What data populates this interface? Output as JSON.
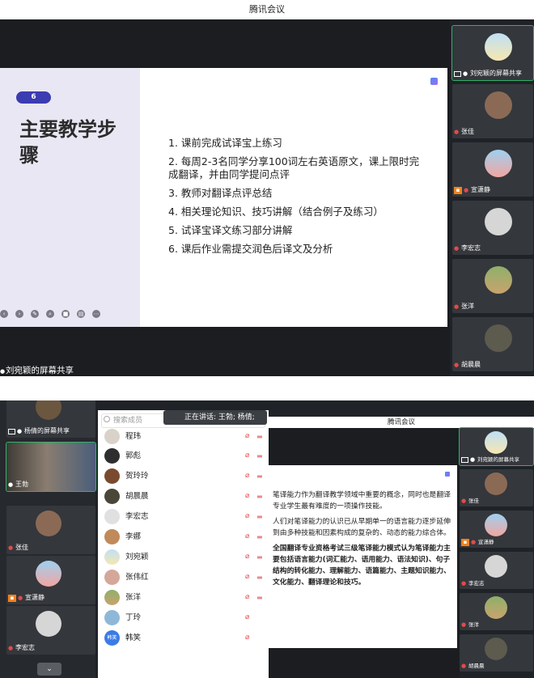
{
  "top_window": {
    "title": "腾讯会议",
    "slide": {
      "badge": "6",
      "title": "主要教学步骤",
      "items": [
        "1. 课前完成试译宝上练习",
        "2. 每周2-3名同学分享100词左右英语原文，课上限时完成翻译，并由同学提问点评",
        "3. 教师对翻译点评总结",
        "4. 相关理论知识、技巧讲解（结合例子及练习）",
        "5. 试译宝译文练习部分讲解",
        "6. 课后作业需提交润色后译文及分析"
      ]
    },
    "share_label": "刘宛颖的屏幕共享",
    "participants": [
      {
        "name": "刘宛颖的屏幕共享",
        "mic": "on",
        "share": true
      },
      {
        "name": "张佳",
        "mic": "off"
      },
      {
        "name": "宣潇静",
        "mic": "off",
        "camera": true
      },
      {
        "name": "李宏志",
        "mic": "off"
      },
      {
        "name": "张洋",
        "mic": "off"
      },
      {
        "name": "胡晨晨",
        "mic": "off"
      }
    ]
  },
  "bottom_window": {
    "title": "腾讯会议",
    "speaking": "正在讲话: 王勃; 杨倩;",
    "search_placeholder": "搜索成员",
    "left_tiles": [
      {
        "name": "杨倩的屏幕共享",
        "mic": "on",
        "share": true
      },
      {
        "name": "王勃",
        "mic": "on"
      },
      {
        "name": "张佳",
        "mic": "off"
      },
      {
        "name": "宣潇静",
        "mic": "off",
        "camera": true
      },
      {
        "name": "李宏志",
        "mic": "off"
      }
    ],
    "members": [
      {
        "name": "程玮"
      },
      {
        "name": "郭彪"
      },
      {
        "name": "贺玲玲"
      },
      {
        "name": "胡晨晨"
      },
      {
        "name": "李宏志"
      },
      {
        "name": "李娜"
      },
      {
        "name": "刘宛颖"
      },
      {
        "name": "张伟红"
      },
      {
        "name": "张洋"
      },
      {
        "name": "丁玲"
      },
      {
        "name": "韩笑",
        "avatar_text": "韩笑"
      }
    ],
    "slide_paragraphs": [
      "笔译能力作为翻译教学领域中重要的概念，同时也是翻译专业学生最有难度的一项操作技能。",
      "人们对笔译能力的认识已从早期单一的语言能力逐步延伸到由多种技能和因素构成的复杂的、动态的能力综合体。",
      "全国翻译专业资格考试三级笔译能力模式认为笔译能力主要包括语言能力(词汇能力、语用能力、语法知识)、句子结构的转化能力、理解能力、语篇能力、主题知识能力、文化能力、翻译理论和技巧。"
    ],
    "right_tiles": [
      {
        "name": "刘宛颖的屏幕共享",
        "mic": "on",
        "share": true
      },
      {
        "name": "张佳",
        "mic": "off"
      },
      {
        "name": "宣潇静",
        "mic": "off",
        "camera": true
      },
      {
        "name": "李宏志",
        "mic": "off"
      },
      {
        "name": "张洋",
        "mic": "off"
      },
      {
        "name": "胡晨晨",
        "mic": "off"
      }
    ]
  },
  "colors": {
    "accent": "#3b3bb2",
    "active_border": "#2fb36a",
    "mute_red": "#e04b4b"
  }
}
